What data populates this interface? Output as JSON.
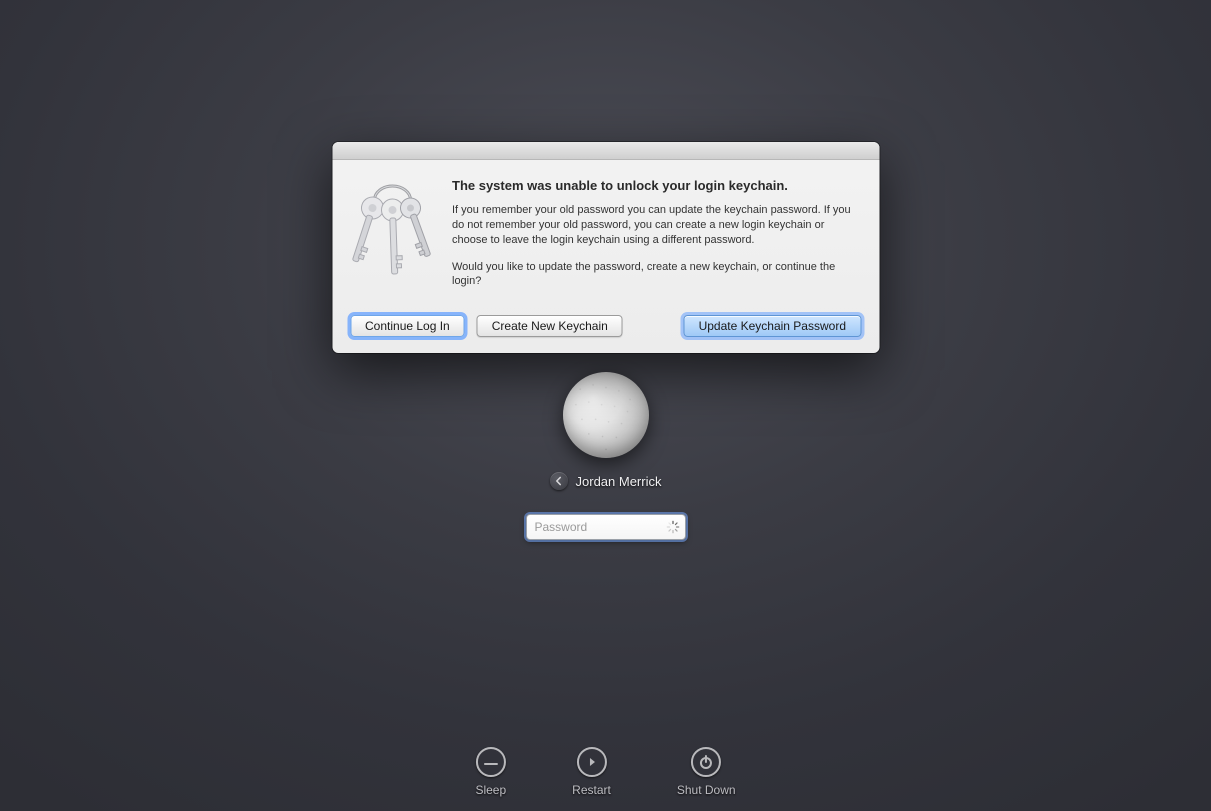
{
  "dialog": {
    "heading": "The system was unable to unlock your login keychain.",
    "para1": "If you remember your old password you can update the keychain password. If you do not remember your old password, you can create a new login keychain or choose to leave the login keychain using a different password.",
    "para2": "Would you like to update the password, create a new keychain, or continue the login?",
    "buttons": {
      "continue": "Continue Log In",
      "create": "Create New Keychain",
      "update": "Update Keychain Password"
    }
  },
  "login": {
    "username": "Jordan Merrick",
    "password_placeholder": "Password",
    "password_value": ""
  },
  "power": {
    "sleep": "Sleep",
    "restart": "Restart",
    "shutdown": "Shut Down"
  }
}
